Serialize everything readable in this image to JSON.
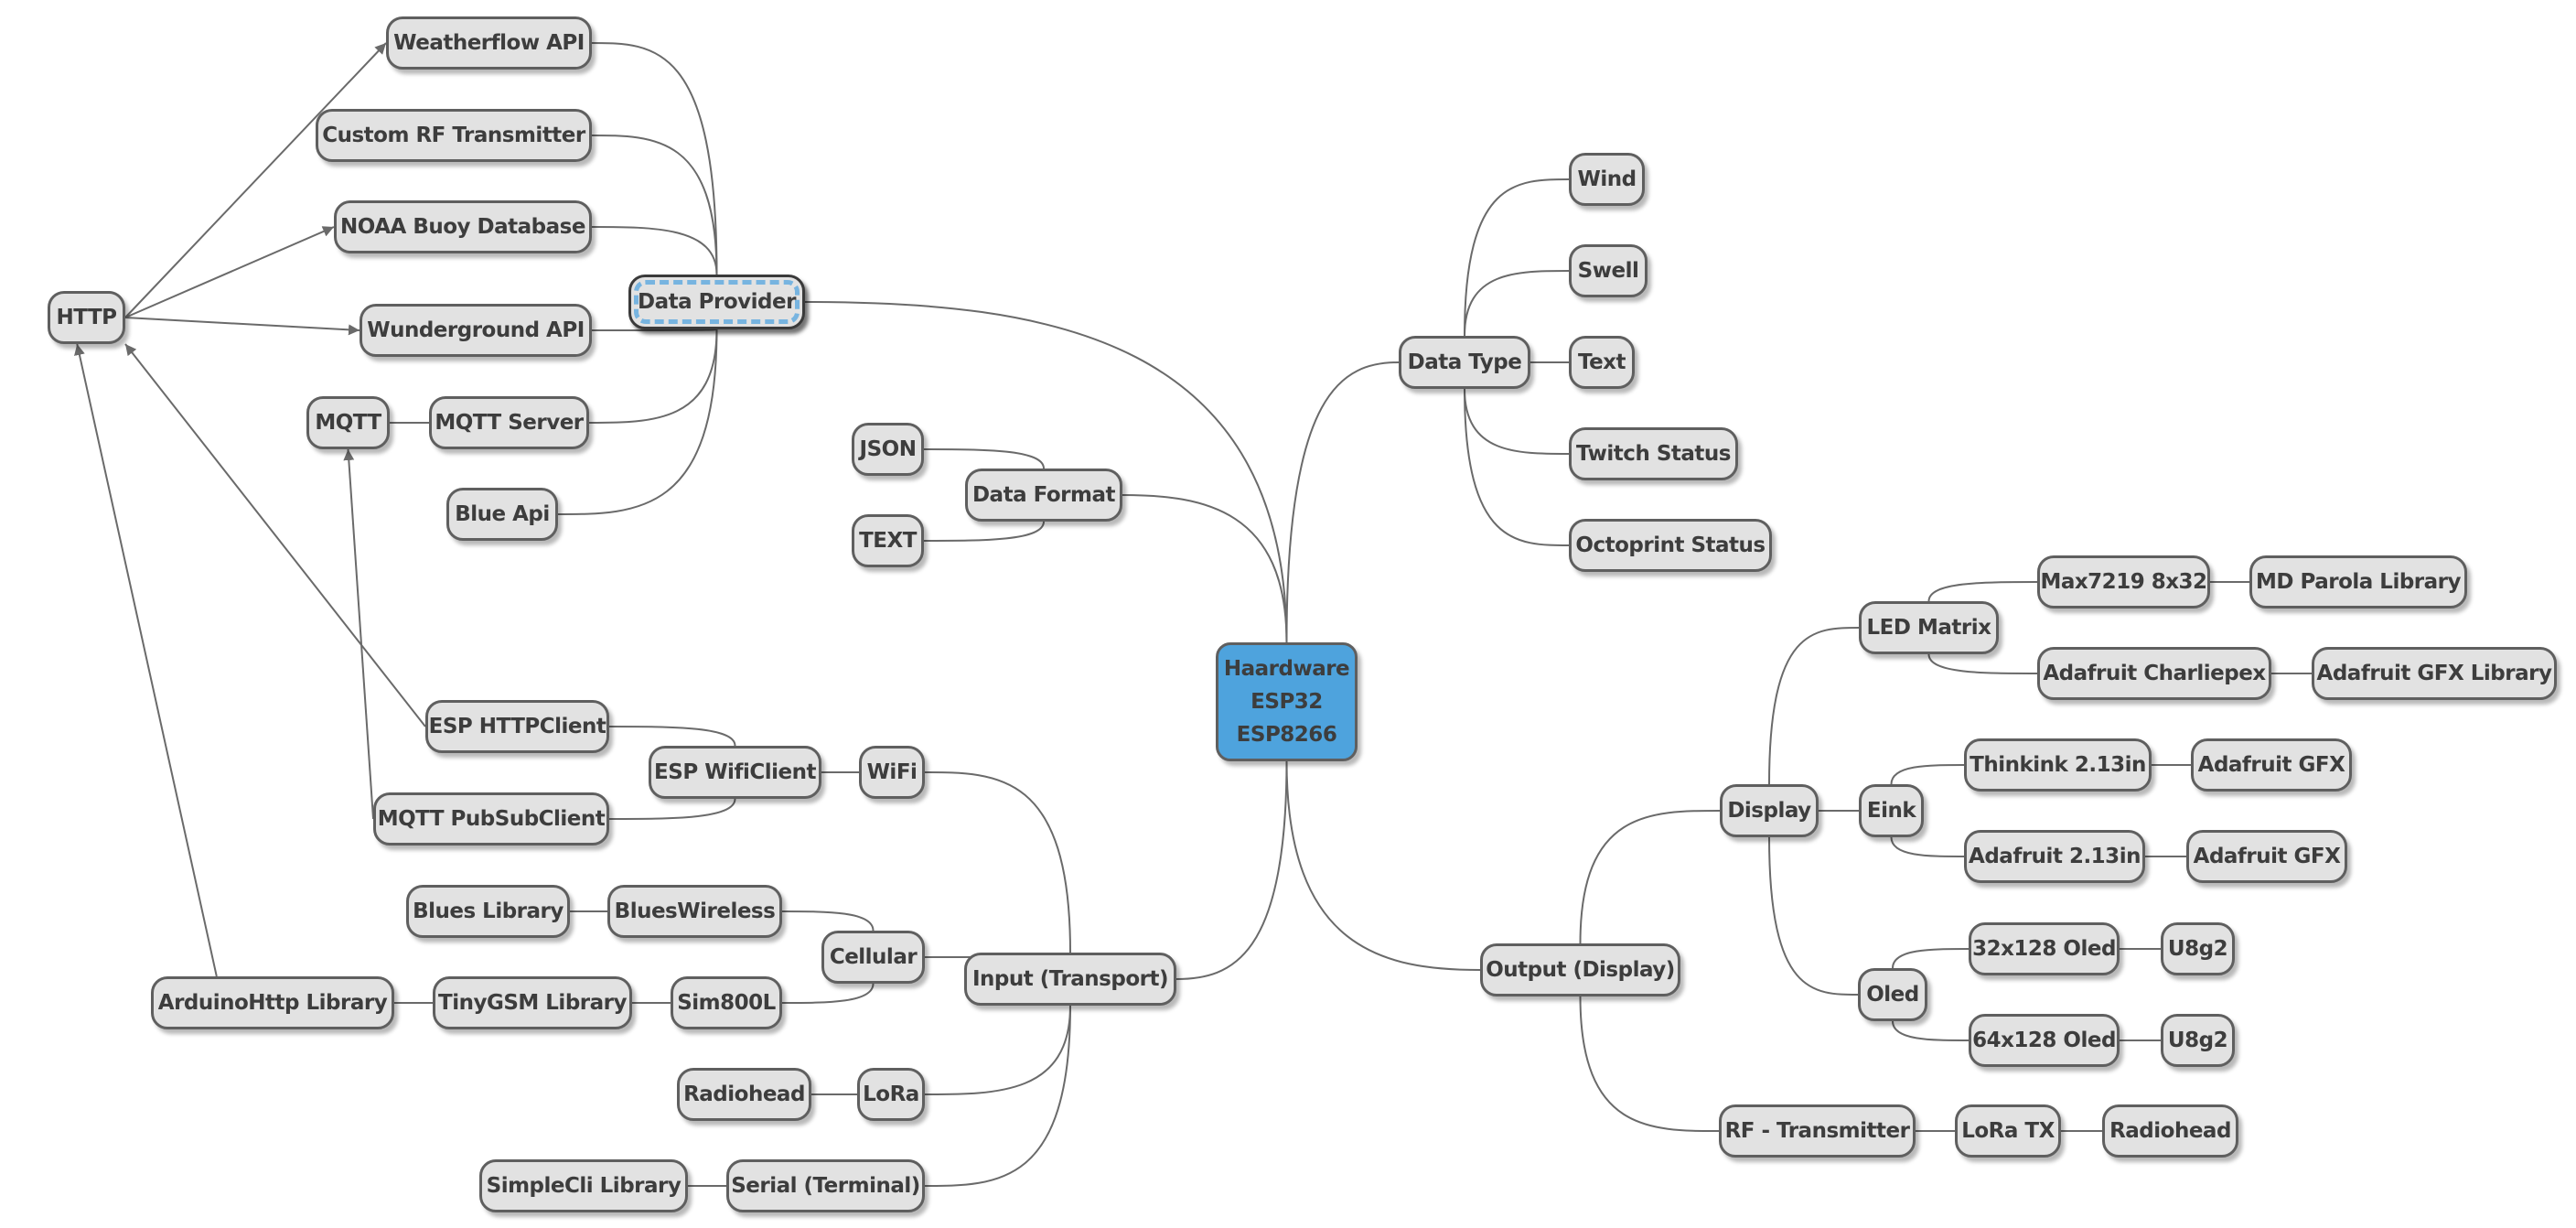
{
  "diagram": {
    "type": "mind-map",
    "colors": {
      "root_fill": "#4ea3dd",
      "node_fill": "#e2e2e2",
      "node_border": "#5f5f5f",
      "text": "#3d3d3d",
      "highlight_dash": "#77b4e0",
      "link": "#6a6a6a"
    },
    "root": {
      "lines": [
        "Haardware",
        "ESP32",
        "ESP8266"
      ]
    },
    "nodes": {
      "data_provider": "Data Provider",
      "weatherflow": "Weatherflow API",
      "custom_rf": "Custom RF Transmitter",
      "noaa": "NOAA Buoy Database",
      "wunderground": "Wunderground API",
      "mqtt_server": "MQTT Server",
      "mqtt": "MQTT",
      "blue_api": "Blue Api",
      "http": "HTTP",
      "json": "JSON",
      "text_fmt": "TEXT",
      "data_format": "Data Format",
      "data_type": "Data Type",
      "wind": "Wind",
      "swell": "Swell",
      "text": "Text",
      "twitch": "Twitch Status",
      "octoprint": "Octoprint Status",
      "output": "Output (Display)",
      "display": "Display",
      "led_matrix": "LED Matrix",
      "max7219": "Max7219 8x32",
      "md_parola": "MD Parola Library",
      "charliepex": "Adafruit Charliepex",
      "gfx_library": "Adafruit GFX Library",
      "eink": "Eink",
      "thinkink": "Thinkink 2.13in",
      "gfx_1": "Adafruit GFX",
      "adafruit_213": "Adafruit 2.13in",
      "gfx_2": "Adafruit GFX",
      "oled": "Oled",
      "oled_32": "32x128 Oled",
      "u8g2_1": "U8g2",
      "oled_64": "64x128 Oled",
      "u8g2_2": "U8g2",
      "rf_tx": "RF - Transmitter",
      "lora_tx": "LoRa TX",
      "radiohead_tx": "Radiohead",
      "input": "Input (Transport)",
      "wifi": "WiFi",
      "esp_wificlient": "ESP WifiClient",
      "esp_httpclient": "ESP HTTPClient",
      "mqtt_pubsub": "MQTT PubSubClient",
      "cellular": "Cellular",
      "blueswireless": "BluesWireless",
      "blues_library": "Blues Library",
      "sim800l": "Sim800L",
      "tinygsm": "TinyGSM Library",
      "arduinohttp": "ArduinoHttp Library",
      "lora": "LoRa",
      "radiohead_rx": "Radiohead",
      "serial": "Serial (Terminal)",
      "simplecli": "SimpleCli Library"
    },
    "edges": [
      [
        "root",
        "data_provider"
      ],
      [
        "root",
        "data_format"
      ],
      [
        "root",
        "data_type"
      ],
      [
        "root",
        "input"
      ],
      [
        "root",
        "output"
      ],
      [
        "data_provider",
        "weatherflow"
      ],
      [
        "data_provider",
        "custom_rf"
      ],
      [
        "data_provider",
        "noaa"
      ],
      [
        "data_provider",
        "wunderground"
      ],
      [
        "data_provider",
        "mqtt_server"
      ],
      [
        "data_provider",
        "blue_api"
      ],
      [
        "mqtt_server",
        "mqtt"
      ],
      [
        "data_format",
        "json"
      ],
      [
        "data_format",
        "text_fmt"
      ],
      [
        "data_type",
        "wind"
      ],
      [
        "data_type",
        "swell"
      ],
      [
        "data_type",
        "text"
      ],
      [
        "data_type",
        "twitch"
      ],
      [
        "data_type",
        "octoprint"
      ],
      [
        "output",
        "display"
      ],
      [
        "output",
        "rf_tx"
      ],
      [
        "display",
        "led_matrix"
      ],
      [
        "display",
        "eink"
      ],
      [
        "display",
        "oled"
      ],
      [
        "led_matrix",
        "max7219"
      ],
      [
        "led_matrix",
        "charliepex"
      ],
      [
        "max7219",
        "md_parola"
      ],
      [
        "charliepex",
        "gfx_library"
      ],
      [
        "eink",
        "thinkink"
      ],
      [
        "eink",
        "adafruit_213"
      ],
      [
        "thinkink",
        "gfx_1"
      ],
      [
        "adafruit_213",
        "gfx_2"
      ],
      [
        "oled",
        "oled_32"
      ],
      [
        "oled",
        "oled_64"
      ],
      [
        "oled_32",
        "u8g2_1"
      ],
      [
        "oled_64",
        "u8g2_2"
      ],
      [
        "rf_tx",
        "lora_tx"
      ],
      [
        "lora_tx",
        "radiohead_tx"
      ],
      [
        "input",
        "wifi"
      ],
      [
        "input",
        "cellular"
      ],
      [
        "input",
        "lora"
      ],
      [
        "input",
        "serial"
      ],
      [
        "wifi",
        "esp_wificlient"
      ],
      [
        "esp_wificlient",
        "esp_httpclient"
      ],
      [
        "esp_wificlient",
        "mqtt_pubsub"
      ],
      [
        "cellular",
        "blueswireless"
      ],
      [
        "cellular",
        "sim800l"
      ],
      [
        "blueswireless",
        "blues_library"
      ],
      [
        "sim800l",
        "tinygsm"
      ],
      [
        "tinygsm",
        "arduinohttp"
      ],
      [
        "lora",
        "radiohead_rx"
      ],
      [
        "serial",
        "simplecli"
      ]
    ],
    "arrows": [
      [
        "http",
        "weatherflow"
      ],
      [
        "http",
        "noaa"
      ],
      [
        "http",
        "wunderground"
      ],
      [
        "esp_httpclient",
        "http"
      ],
      [
        "arduinohttp",
        "http"
      ],
      [
        "mqtt_pubsub",
        "mqtt"
      ]
    ]
  }
}
